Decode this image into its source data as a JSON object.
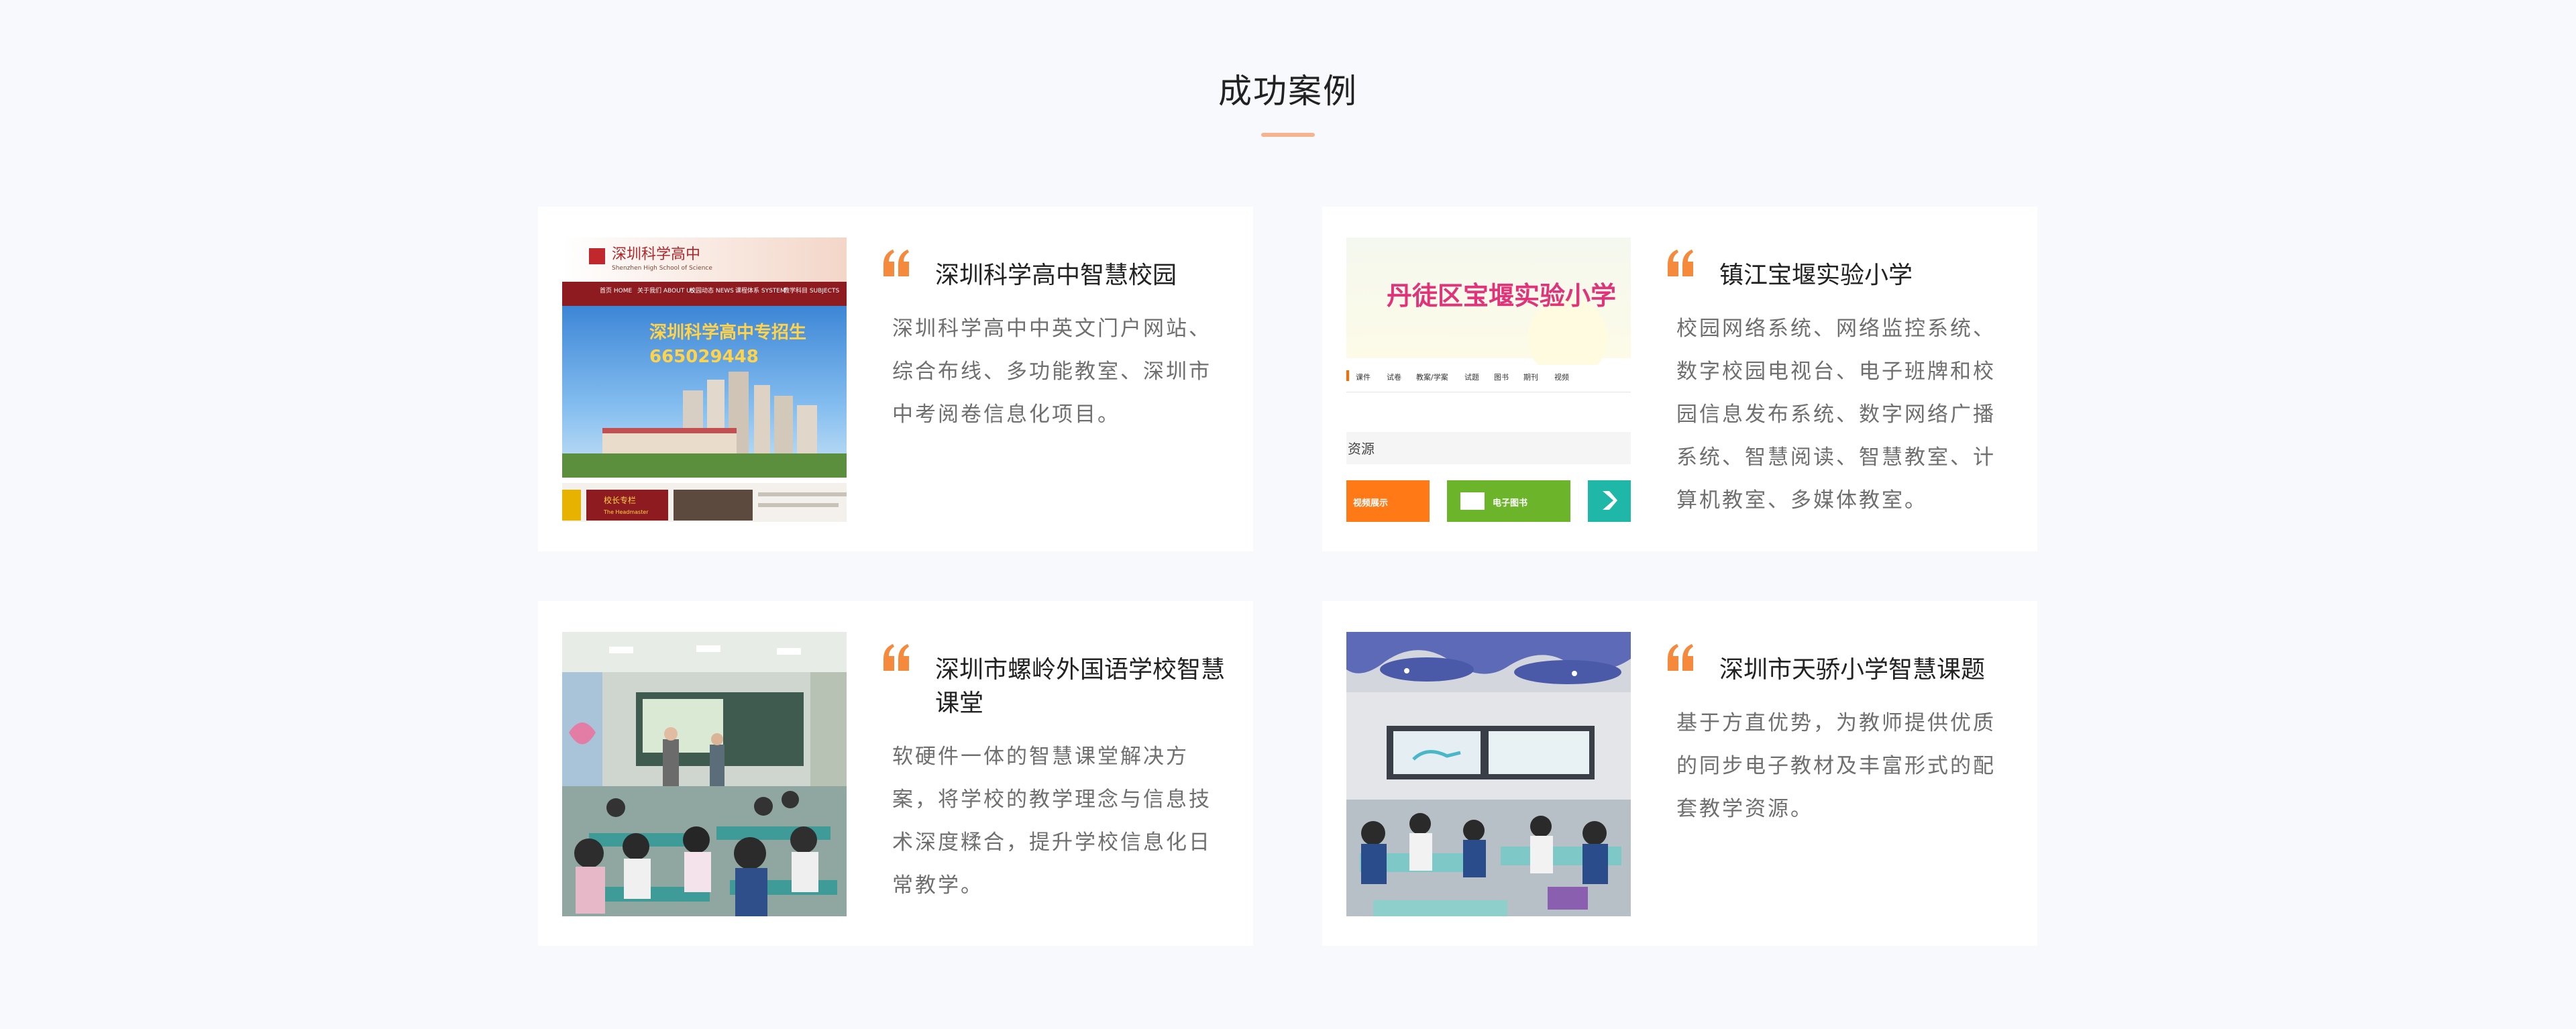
{
  "section": {
    "title": "成功案例"
  },
  "colors": {
    "accent": "#f58a3c",
    "title_bar": "#f6b38f"
  },
  "cases": [
    {
      "title": "深圳科学高中智慧校园",
      "desc": "深圳科学高中中英文门户网站、综合布线、多功能教室、深圳市中考阅卷信息化项目。",
      "thumb": {
        "logo_cn": "深圳科学高中",
        "logo_en": "Shenzhen High School of Science",
        "nav": [
          "首页 HOME",
          "关于我们 ABOUT US",
          "校园动态 NEWS",
          "课程体系 SYSTEM",
          "教学科目 SUBJECTS"
        ],
        "banner_text": "深圳科学高中专招生",
        "banner_phone": "665029448",
        "footer_label": "校长专栏",
        "footer_label_en": "The Headmaster"
      }
    },
    {
      "title": "镇江宝堰实验小学",
      "desc": "校园网络系统、网络监控系统、数字校园电视台、电子班牌和校园信息发布系统、数字网络广播系统、智慧阅读、智慧教室、计算机教室、多媒体教室。",
      "thumb": {
        "banner_text": "丹徒区宝堰实验小学",
        "tabs": [
          "课件",
          "试卷",
          "教案/学案",
          "试题",
          "图书",
          "期刊",
          "视频"
        ],
        "resource_label": "资源",
        "tiles": [
          "视频展示",
          "电子图书"
        ]
      }
    },
    {
      "title": "深圳市螺岭外国语学校智慧课堂",
      "desc": "软硬件一体的智慧课堂解决方案，将学校的教学理念与信息技术深度糅合，提升学校信息化日常教学。"
    },
    {
      "title": "深圳市天骄小学智慧课题",
      "desc": "基于方直优势，为教师提供优质的同步电子教材及丰富形式的配套教学资源。"
    }
  ]
}
